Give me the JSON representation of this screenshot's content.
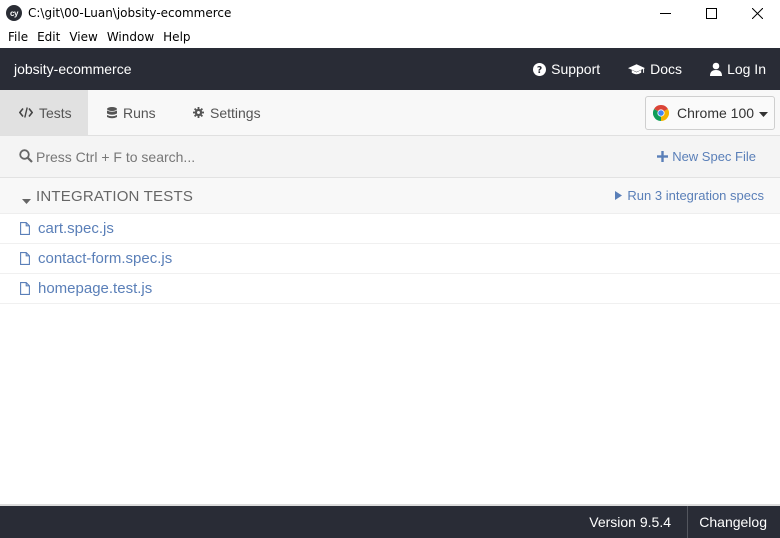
{
  "window": {
    "logo_text": "cy",
    "title": "C:\\git\\00-Luan\\jobsity-ecommerce"
  },
  "menu": [
    "File",
    "Edit",
    "View",
    "Window",
    "Help"
  ],
  "header": {
    "project": "jobsity-ecommerce",
    "support_label": "Support",
    "docs_label": "Docs",
    "login_label": "Log In"
  },
  "tabs": [
    {
      "label": "Tests",
      "icon": "code-icon",
      "active": true
    },
    {
      "label": "Runs",
      "icon": "database-icon",
      "active": false
    },
    {
      "label": "Settings",
      "icon": "gear-icon",
      "active": false
    }
  ],
  "browser": {
    "label": "Chrome 100",
    "icon": "chrome-icon"
  },
  "search": {
    "placeholder": "Press Ctrl + F to search..."
  },
  "new_spec_label": "New Spec File",
  "integration": {
    "title": "INTEGRATION TESTS",
    "run_label": "Run 3 integration specs"
  },
  "specs": [
    {
      "name": "cart.spec.js"
    },
    {
      "name": "contact-form.spec.js"
    },
    {
      "name": "homepage.test.js"
    }
  ],
  "footer": {
    "version": "Version 9.5.4",
    "changelog": "Changelog"
  },
  "colors": {
    "header_bg": "#292c36",
    "link_blue": "#5a7fb8",
    "active_tab": "#e1e1e1"
  }
}
